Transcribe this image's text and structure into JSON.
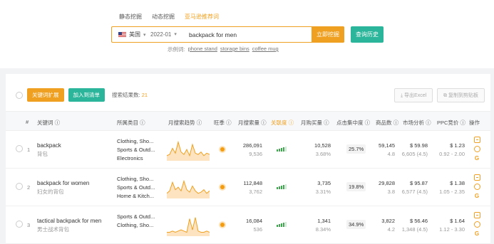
{
  "tabs": [
    "静态挖掘",
    "动态挖掘",
    "亚马逊推荐词"
  ],
  "search": {
    "country": "美国",
    "date": "2022-01",
    "keyword": "backpack for men",
    "button": "立即挖掘",
    "history_button": "查询历史"
  },
  "examples": {
    "label": "示例词:",
    "items": [
      "phone stand",
      "storage bins",
      "coffee mug"
    ]
  },
  "toolbar": {
    "keyword_button": "关键词扩展",
    "add_button": "加入到清单",
    "count_label": "搜索结果数:",
    "count": "21",
    "export": "导出Excel",
    "copy": "复制到剪贴板"
  },
  "headers": {
    "num": "#",
    "keyword": "关键词 ⓘ",
    "category": "所属类目 ⓘ",
    "trend": "月搜索趋势 ⓘ",
    "season": "旺季 ⓘ",
    "volume": "月搜索量 ⓘ",
    "relevance": "关联度 ⓘ",
    "purchases": "月购买量 ⓘ",
    "concentration": "点击集中度 ⓘ",
    "products": "商品数 ⓘ",
    "market": "市场分析 ⓘ",
    "ppc": "PPC竞价 ⓘ",
    "ops": "操作"
  },
  "rows": [
    {
      "index": "1",
      "keyword": "backpack",
      "keyword_cn": "背包",
      "categories": [
        "Clothing, Sho...",
        "Sports & Outd...",
        "Electronics"
      ],
      "volume": "286,091",
      "volume_sub": "9,536",
      "purchases": "10,528",
      "purchases_pct": "3.68%",
      "concentration": "25.7%",
      "products": "59,145",
      "products_sub": "4.8",
      "price": "$ 59.98",
      "reviews": "6,605 (4.5)",
      "ppc": "$ 1.23",
      "ppc_range": "0.92 - 2.00",
      "trend": [
        3,
        4,
        9,
        5,
        14,
        6,
        4,
        8,
        3,
        12,
        5,
        4,
        6,
        3,
        5,
        4
      ],
      "signal_level": 4
    },
    {
      "index": "2",
      "keyword": "backpack for women",
      "keyword_cn": "妇女的背包",
      "categories": [
        "Clothing, Sho...",
        "Sports & Outd...",
        "Home & Kitch..."
      ],
      "volume": "112,848",
      "volume_sub": "3,762",
      "purchases": "3,735",
      "purchases_pct": "3.31%",
      "concentration": "19.8%",
      "products": "29,828",
      "products_sub": "3.8",
      "price": "$ 95.87",
      "reviews": "6,577 (4.5)",
      "ppc": "$ 1.38",
      "ppc_range": "1.05 - 2.35",
      "trend": [
        3,
        5,
        12,
        6,
        8,
        5,
        13,
        6,
        4,
        9,
        5,
        3,
        4,
        6,
        3,
        5
      ],
      "signal_level": 4
    },
    {
      "index": "3",
      "keyword": "tactical backpack for men",
      "keyword_cn": "男士战术背包",
      "categories": [
        "Sports & Outd...",
        "Clothing, Sho..."
      ],
      "volume": "16,084",
      "volume_sub": "536",
      "purchases": "1,341",
      "purchases_pct": "8.34%",
      "concentration": "34.9%",
      "products": "3,822",
      "products_sub": "4.2",
      "price": "$ 56.46",
      "reviews": "1,348 (4.5)",
      "ppc": "$ 1.64",
      "ppc_range": "1.12 - 3.30",
      "trend": [
        2,
        2,
        3,
        2,
        3,
        4,
        3,
        2,
        13,
        4,
        14,
        3,
        2,
        2,
        3,
        2
      ],
      "signal_level": 4
    }
  ],
  "colors": {
    "accent": "#f0a020",
    "green": "#2bb59a",
    "signal": "#3ca84b"
  }
}
